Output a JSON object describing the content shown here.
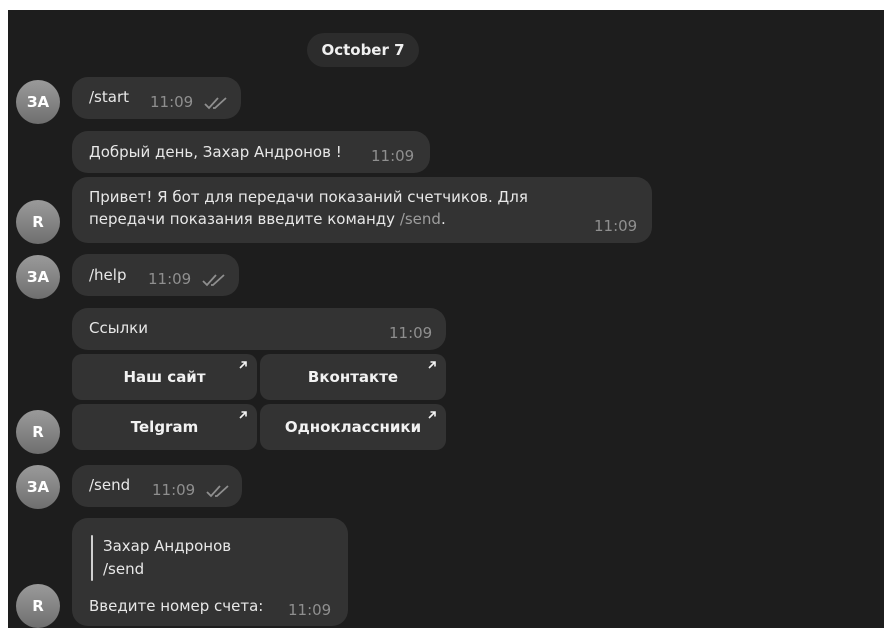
{
  "date_label": "October 7",
  "user_initials": "ЗА",
  "bot_initial": "R",
  "messages": {
    "m1": {
      "text": "/start",
      "time": "11:09"
    },
    "m2": {
      "text": "Добрый день, Захар Андронов !",
      "time": "11:09"
    },
    "m3": {
      "line1": "Привет! Я бот для передачи показаний счетчиков. Для",
      "line2_pre": "передачи показания введите команду ",
      "line2_cmd": "/send",
      "line2_post": ".",
      "time": "11:09"
    },
    "m4": {
      "text": "/help",
      "time": "11:09"
    },
    "m5": {
      "text": "Ссылки",
      "time": "11:09"
    },
    "m6": {
      "text": "/send",
      "time": "11:09"
    },
    "m7": {
      "quote_author": "Захар Андронов",
      "quote_text": "/send",
      "text": "Введите номер счета:",
      "time": "11:09"
    }
  },
  "keyboard": {
    "site": "Наш сайт",
    "vk": "Вконтакте",
    "telegram": "Telgram",
    "ok": "Одноклассники"
  },
  "colors": {
    "background": "#1d1d1d",
    "bubble": "#333333",
    "date_pill": "#2c2c2c",
    "time": "#8f8f8f",
    "command": "#9d9d9d"
  },
  "icons": {
    "read_status": "double-check-icon",
    "link": "arrow-up-right-icon"
  }
}
